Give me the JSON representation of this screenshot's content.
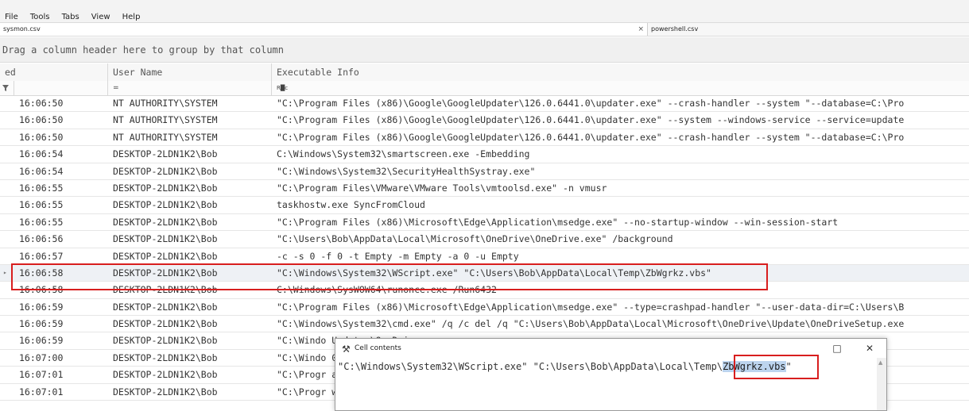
{
  "menu": [
    "File",
    "Tools",
    "Tabs",
    "View",
    "Help"
  ],
  "tabs": [
    {
      "label": "sysmon.csv",
      "close": "×"
    },
    {
      "label": "powershell.csv"
    }
  ],
  "group_hint": "Drag a column header here to group by that column",
  "columns": [
    "ed",
    "User Name",
    "Executable Info"
  ],
  "filter": {
    "user_name": "=",
    "executable_info": "R█c"
  },
  "rows": [
    {
      "time": "16:06:50",
      "user": "NT AUTHORITY\\SYSTEM",
      "exe": "\"C:\\Program Files (x86)\\Google\\GoogleUpdater\\126.0.6441.0\\updater.exe\" --crash-handler --system \"--database=C:\\Pro"
    },
    {
      "time": "16:06:50",
      "user": "NT AUTHORITY\\SYSTEM",
      "exe": "\"C:\\Program Files (x86)\\Google\\GoogleUpdater\\126.0.6441.0\\updater.exe\" --system --windows-service --service=update"
    },
    {
      "time": "16:06:50",
      "user": "NT AUTHORITY\\SYSTEM",
      "exe": "\"C:\\Program Files (x86)\\Google\\GoogleUpdater\\126.0.6441.0\\updater.exe\" --crash-handler --system \"--database=C:\\Pro"
    },
    {
      "time": "16:06:54",
      "user": "DESKTOP-2LDN1K2\\Bob",
      "exe": "C:\\Windows\\System32\\smartscreen.exe -Embedding"
    },
    {
      "time": "16:06:54",
      "user": "DESKTOP-2LDN1K2\\Bob",
      "exe": "\"C:\\Windows\\System32\\SecurityHealthSystray.exe\""
    },
    {
      "time": "16:06:55",
      "user": "DESKTOP-2LDN1K2\\Bob",
      "exe": "\"C:\\Program Files\\VMware\\VMware Tools\\vmtoolsd.exe\" -n vmusr"
    },
    {
      "time": "16:06:55",
      "user": "DESKTOP-2LDN1K2\\Bob",
      "exe": "taskhostw.exe SyncFromCloud"
    },
    {
      "time": "16:06:55",
      "user": "DESKTOP-2LDN1K2\\Bob",
      "exe": "\"C:\\Program Files (x86)\\Microsoft\\Edge\\Application\\msedge.exe\" --no-startup-window --win-session-start"
    },
    {
      "time": "16:06:56",
      "user": "DESKTOP-2LDN1K2\\Bob",
      "exe": "\"C:\\Users\\Bob\\AppData\\Local\\Microsoft\\OneDrive\\OneDrive.exe\" /background"
    },
    {
      "time": "16:06:57",
      "user": "DESKTOP-2LDN1K2\\Bob",
      "exe": " -c -s 0 -f 0 -t Empty -m Empty -a 0 -u Empty"
    },
    {
      "time": "16:06:58",
      "user": "DESKTOP-2LDN1K2\\Bob",
      "exe": "\"C:\\Windows\\System32\\WScript.exe\" \"C:\\Users\\Bob\\AppData\\Local\\Temp\\ZbWgrkz.vbs\"",
      "selected": true,
      "marker": "▸"
    },
    {
      "time": "16:06:58",
      "user": "DESKTOP-2LDN1K2\\Bob",
      "exe": "C:\\Windows\\SysWOW64\\runonce.exe /Run6432"
    },
    {
      "time": "16:06:59",
      "user": "DESKTOP-2LDN1K2\\Bob",
      "exe": "\"C:\\Program Files (x86)\\Microsoft\\Edge\\Application\\msedge.exe\" --type=crashpad-handler \"--user-data-dir=C:\\Users\\B"
    },
    {
      "time": "16:06:59",
      "user": "DESKTOP-2LDN1K2\\Bob",
      "exe": "\"C:\\Windows\\System32\\cmd.exe\" /q /c del /q \"C:\\Users\\Bob\\AppData\\Local\\Microsoft\\OneDrive\\Update\\OneDriveSetup.exe"
    },
    {
      "time": "16:06:59",
      "user": "DESKTOP-2LDN1K2\\Bob",
      "exe": "\"C:\\Windo                                                                                    Updater\\OneDri"
    },
    {
      "time": "16:07:00",
      "user": "DESKTOP-2LDN1K2\\Bob",
      "exe": "\"C:\\Windo                                                                                    0.1024.0005\\ar"
    },
    {
      "time": "16:07:01",
      "user": "DESKTOP-2LDN1K2\\Bob",
      "exe": "\"C:\\Progr                                                                                    ar --gpu-prefe"
    },
    {
      "time": "16:07:01",
      "user": "DESKTOP-2LDN1K2\\Bob",
      "exe": "\"C:\\Progr                                                                                    work.mojom.Net"
    }
  ],
  "dialog": {
    "title": "Cell contents",
    "icon": "cell-contents-icon",
    "maximize": "□",
    "close": "✕",
    "text_prefix": "\"C:\\Windows\\System32\\WScript.exe\" \"C:\\Users\\Bob\\AppData\\Local\\Temp\\",
    "text_selected": "ZbWgrkz.vbs",
    "text_suffix": "\"",
    "scroll_up": "▲"
  },
  "colors": {
    "highlight_box": "#d81e1e",
    "selection": "#bcd4ee",
    "selected_row": "#eef1f5"
  }
}
